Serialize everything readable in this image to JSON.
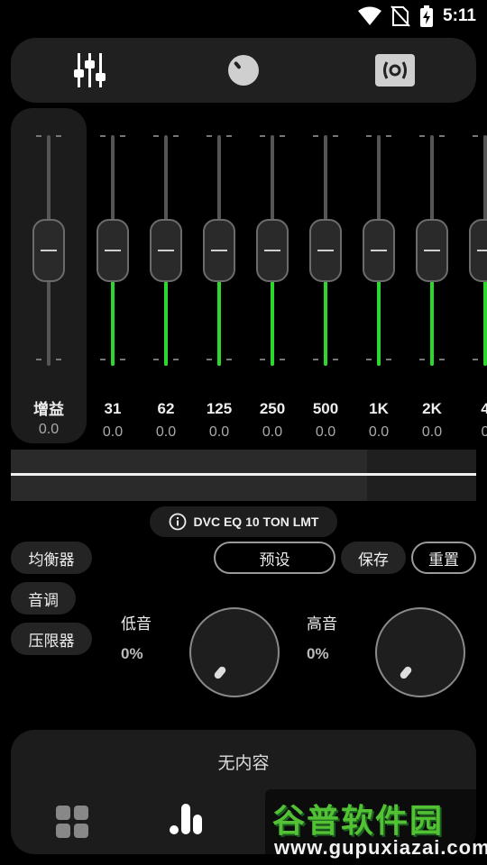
{
  "status_bar": {
    "time": "5:11",
    "icons": [
      "wifi-icon",
      "no-sim-icon",
      "battery-charging-icon"
    ]
  },
  "top_tabs": [
    {
      "name": "equalizer-sliders-icon"
    },
    {
      "name": "knob-icon"
    },
    {
      "name": "speaker-icon"
    }
  ],
  "gain": {
    "label": "增益",
    "value": "0.0",
    "level": 0.5
  },
  "bands": [
    {
      "label": "31",
      "value": "0.0",
      "level": 0.5
    },
    {
      "label": "62",
      "value": "0.0",
      "level": 0.5
    },
    {
      "label": "125",
      "value": "0.0",
      "level": 0.5
    },
    {
      "label": "250",
      "value": "0.0",
      "level": 0.5
    },
    {
      "label": "500",
      "value": "0.0",
      "level": 0.5
    },
    {
      "label": "1K",
      "value": "0.0",
      "level": 0.5
    },
    {
      "label": "2K",
      "value": "0.0",
      "level": 0.5
    },
    {
      "label": "4",
      "value": "0",
      "level": 0.5
    }
  ],
  "preset_chip": {
    "text": "DVC EQ 10 TON LMT",
    "icon": "info-icon"
  },
  "side_tabs": {
    "equalizer": "均衡器",
    "tone": "音调",
    "limiter": "压限器"
  },
  "actions": {
    "preset": "预设",
    "save": "保存",
    "reset": "重置"
  },
  "bass": {
    "label": "低音",
    "value": "0%"
  },
  "treble": {
    "label": "高音",
    "value": "0%"
  },
  "bottom": {
    "title": "无内容",
    "icons": [
      "grid-icon",
      "bars-icon"
    ]
  },
  "watermark": {
    "title": "谷普软件园",
    "url": "www.gupuxiazai.com"
  },
  "colors": {
    "accent_green": "#2bd82b",
    "panel": "#1c1c1c",
    "background": "#000000"
  }
}
